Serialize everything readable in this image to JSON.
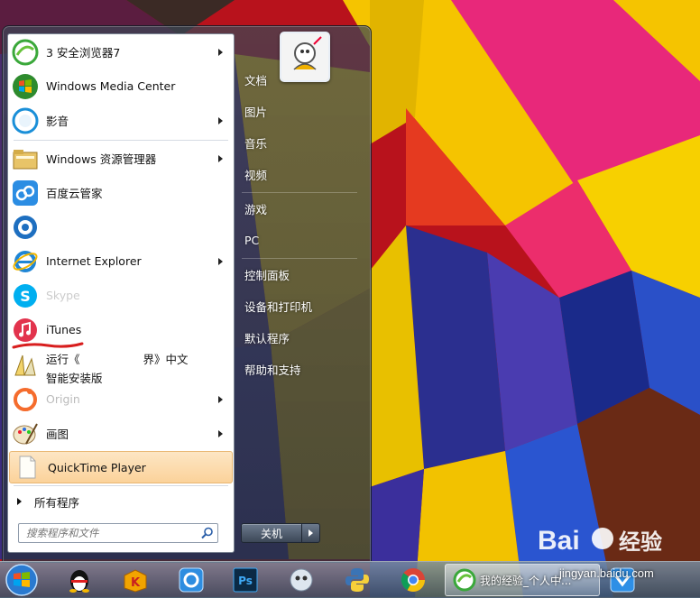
{
  "start_menu": {
    "programs": [
      {
        "label": "3  安全浏览器7",
        "icon": "browser-360-icon",
        "arrow": true
      },
      {
        "label": "Windows Media Center",
        "icon": "media-center-icon",
        "arrow": false
      },
      {
        "label": "影音",
        "icon": "video-player-icon",
        "arrow": true
      },
      {
        "label": "Windows 资源管理器",
        "icon": "file-explorer-icon",
        "arrow": true
      },
      {
        "label": "百度云管家",
        "icon": "baidu-cloud-icon",
        "arrow": false
      },
      {
        "label": "",
        "icon": "app-icon",
        "arrow": false
      },
      {
        "label": "Internet Explorer",
        "icon": "internet-explorer-icon",
        "arrow": true
      },
      {
        "label": "Skype",
        "icon": "skype-icon",
        "arrow": false
      },
      {
        "label": "iTunes",
        "icon": "itunes-icon",
        "arrow": false
      },
      {
        "label": "运行《",
        "label2": "界》中文",
        "label3": "智能安装版",
        "icon": "installer-icon",
        "arrow": false
      },
      {
        "label": "Origin",
        "icon": "origin-icon",
        "arrow": true
      },
      {
        "label": "画图",
        "icon": "paint-icon",
        "arrow": true
      },
      {
        "label": "QuickTime Player",
        "icon": "quicktime-icon",
        "arrow": false
      }
    ],
    "all_programs": "所有程序",
    "search_placeholder": "搜索程序和文件",
    "right_items": [
      "文档",
      "图片",
      "音乐",
      "视频",
      "游戏",
      "PC",
      "控制面板",
      "设备和打印机",
      "默认程序",
      "帮助和支持"
    ],
    "shutdown_label": "关机"
  },
  "taskbar": {
    "active_window_title": "我的经验_个人中..."
  },
  "watermark": {
    "text": "jingyan.baidu.com"
  }
}
